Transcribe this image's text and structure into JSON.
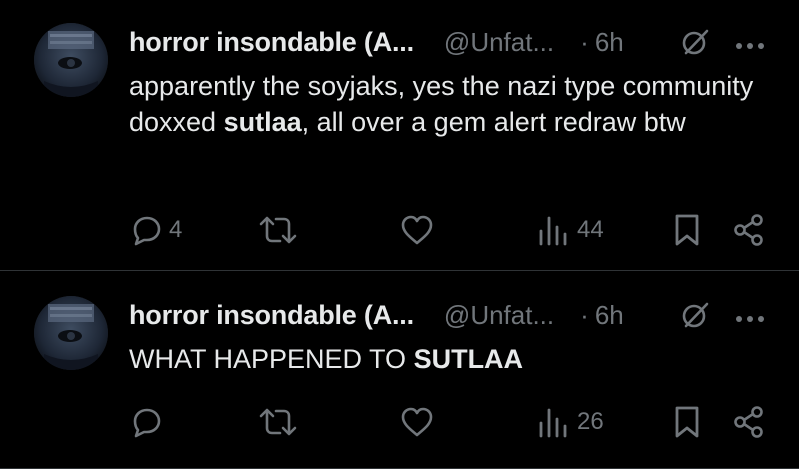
{
  "tweets": [
    {
      "author_name": "horror insondable (A...",
      "handle": "@Unfat...",
      "separator": "·",
      "time": "6h",
      "text_parts": {
        "before": "apparently the soyjaks, yes the nazi type community doxxed ",
        "bold": "sutlaa",
        "after": ", all over a gem alert redraw btw"
      },
      "replies": "4",
      "reposts": "",
      "likes": "",
      "views": "44",
      "icons": [
        "speech-bubble-icon",
        "repost-icon",
        "heart-icon",
        "views-bar-chart-icon",
        "bookmark-icon",
        "share-icon",
        "grok-icon",
        "more-dots-icon"
      ]
    },
    {
      "author_name": "horror insondable (A...",
      "handle": "@Unfat...",
      "separator": "·",
      "time": "6h",
      "text_parts": {
        "before": "WHAT HAPPENED TO ",
        "bold": "SUTLAA",
        "after": ""
      },
      "replies": "",
      "reposts": "",
      "likes": "",
      "views": "26",
      "icons": [
        "speech-bubble-icon",
        "repost-icon",
        "heart-icon",
        "views-bar-chart-icon",
        "bookmark-icon",
        "share-icon",
        "grok-icon",
        "more-dots-icon"
      ]
    }
  ],
  "colors": {
    "background": "#000000",
    "primary_text": "#e7e9ea",
    "secondary_text": "#71767b",
    "divider": "#2f3336"
  }
}
